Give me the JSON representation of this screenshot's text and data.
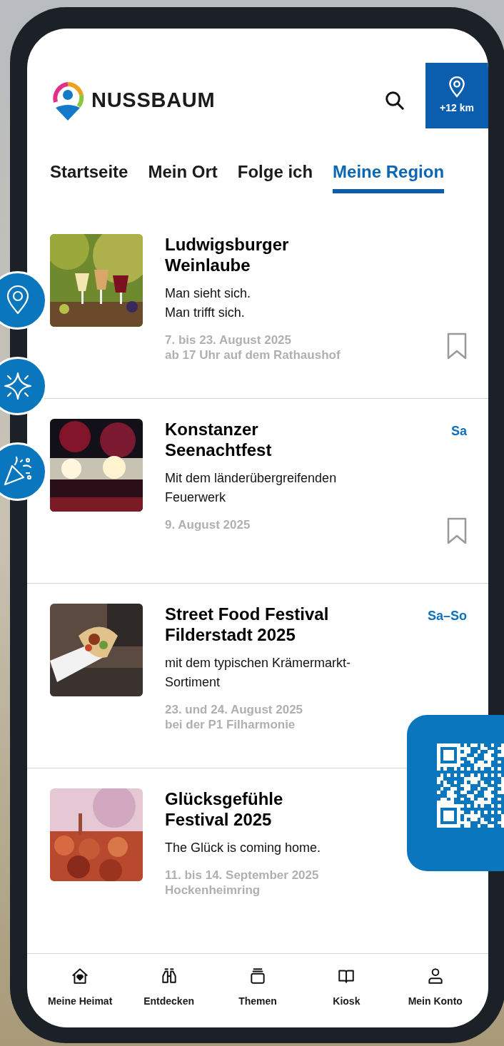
{
  "header": {
    "brand": "NUSSBAUM",
    "radius": "+12 km"
  },
  "tabs": [
    {
      "label": "Startseite",
      "selected": false
    },
    {
      "label": "Mein Ort",
      "selected": false
    },
    {
      "label": "Folge ich",
      "selected": false
    },
    {
      "label": "Meine Region",
      "selected": true
    }
  ],
  "events": [
    {
      "title": "Ludwigsburger Weinlaube",
      "description": "Man sieht sich.\nMan trifft sich.",
      "details": [
        "7. bis 23. August 2025",
        "ab 17 Uhr auf dem Rathaushof"
      ],
      "bookmarked": false
    },
    {
      "title": "Konstanzer Seenachtfest",
      "description": "Mit dem länderübergreifenden Feuerwerk",
      "details": [
        "9. August 2025"
      ],
      "day": "Sa",
      "bookmarked": false
    },
    {
      "title": "Street Food Festival Filderstadt 2025",
      "description": "mit dem typischen Krämermarkt-Sortiment",
      "details": [
        "23. und 24. August 2025",
        "bei der P1 Filharmonie"
      ],
      "day": "Sa–So"
    },
    {
      "title": "Glücksgefühle Festival 2025",
      "description": "The Glück is coming home.",
      "details": [
        "11. bis 14. September 2025",
        "Hockenheimring"
      ]
    }
  ],
  "nav": [
    {
      "label": "Meine Heimat"
    },
    {
      "label": "Entdecken"
    },
    {
      "label": "Themen"
    },
    {
      "label": "Kiosk"
    },
    {
      "label": "Mein Konto"
    }
  ]
}
